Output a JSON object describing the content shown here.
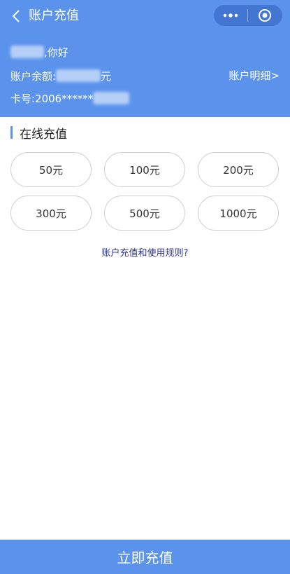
{
  "nav": {
    "title": "账户充值",
    "back_icon": "back-arrow-icon",
    "more_icon": "more-dots-icon",
    "close_icon": "target-circle-icon"
  },
  "account": {
    "greeting_suffix": ",你好",
    "balance_prefix": "账户余额:",
    "balance_unit": "元",
    "detail_link": "账户明细>",
    "card_prefix": "卡号:2006******"
  },
  "section": {
    "title": "在线充值"
  },
  "amounts": [
    {
      "label": "50元"
    },
    {
      "label": "100元"
    },
    {
      "label": "200元"
    },
    {
      "label": "300元"
    },
    {
      "label": "500元"
    },
    {
      "label": "1000元"
    }
  ],
  "rules_link": "账户充值和使用规则?",
  "submit_label": "立即充值",
  "colors": {
    "primary": "#5b93ec",
    "link": "#2c3598"
  }
}
